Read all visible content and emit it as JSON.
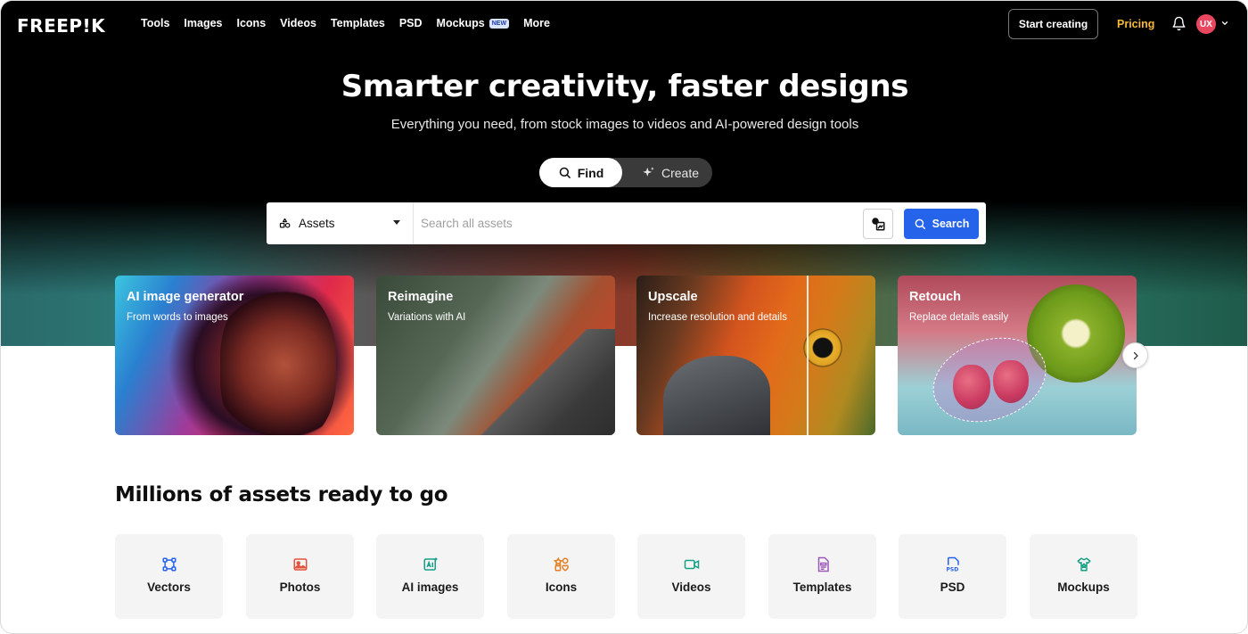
{
  "nav": {
    "logo": "FREEP!K",
    "links": [
      "Tools",
      "Images",
      "Icons",
      "Videos",
      "Templates",
      "PSD",
      "Mockups",
      "More"
    ],
    "mockups_badge": "NEW",
    "start_creating": "Start creating",
    "pricing": "Pricing",
    "avatar_initials": "UX",
    "colors": {
      "pricing": "#f5b833",
      "avatar_bg": "#e8475f"
    }
  },
  "hero": {
    "title": "Smarter creativity, faster designs",
    "subtitle": "Everything you need, from stock images to videos and AI-powered design tools",
    "toggle": {
      "find": "Find",
      "create": "Create",
      "active": "Find"
    }
  },
  "search": {
    "asset_type": "Assets",
    "placeholder": "Search all assets",
    "value": "",
    "button": "Search",
    "button_color": "#2563eb"
  },
  "tools": [
    {
      "title": "AI image generator",
      "subtitle": "From words to images"
    },
    {
      "title": "Reimagine",
      "subtitle": "Variations with AI"
    },
    {
      "title": "Upscale",
      "subtitle": "Increase resolution and details"
    },
    {
      "title": "Retouch",
      "subtitle": "Replace details easily"
    }
  ],
  "section": {
    "title": "Millions of assets ready to go",
    "categories": [
      {
        "label": "Vectors",
        "icon": "vector-nodes-icon",
        "color": "#2563eb"
      },
      {
        "label": "Photos",
        "icon": "photo-icon",
        "color": "#e5533d"
      },
      {
        "label": "AI images",
        "icon": "ai-image-icon",
        "color": "#16a085"
      },
      {
        "label": "Icons",
        "icon": "icons-shapes-icon",
        "color": "#e67e22"
      },
      {
        "label": "Videos",
        "icon": "video-camera-icon",
        "color": "#16a085"
      },
      {
        "label": "Templates",
        "icon": "template-doc-icon",
        "color": "#9b59b6"
      },
      {
        "label": "PSD",
        "icon": "psd-file-icon",
        "color": "#2563eb"
      },
      {
        "label": "Mockups",
        "icon": "mockup-shirt-icon",
        "color": "#16a085"
      }
    ]
  }
}
